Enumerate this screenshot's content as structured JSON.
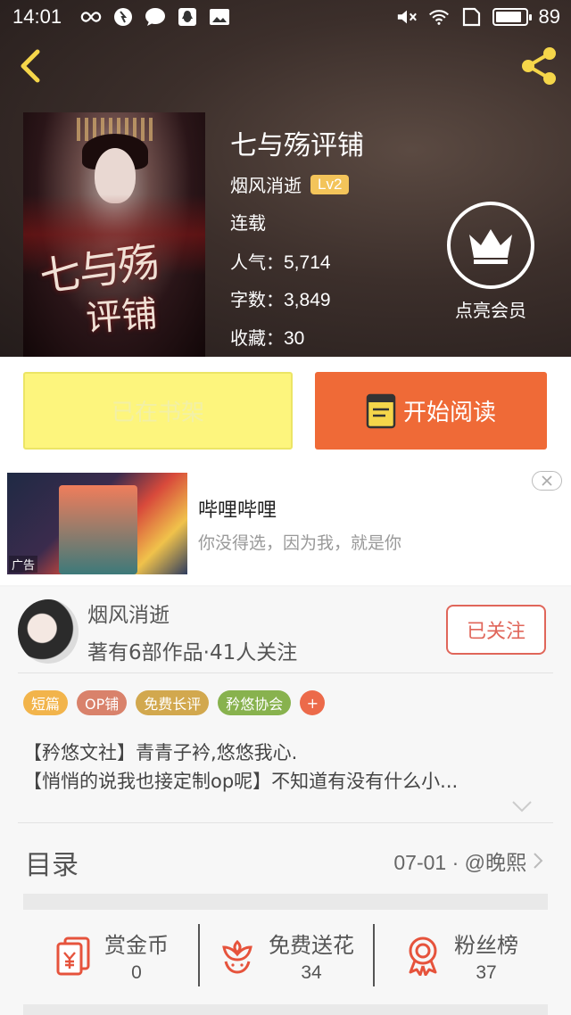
{
  "status_bar": {
    "time": "14:01",
    "battery_pct": "89",
    "battery_level": 0.89
  },
  "book": {
    "title": "七与殇评铺",
    "author": "烟风消逝",
    "level": "Lv2",
    "status": "连载",
    "popularity_label": "人气：",
    "popularity": "5,714",
    "words_label": "字数：",
    "words": "3,849",
    "favorites_label": "收藏：",
    "favorites": "30",
    "cover_title": "七与殇",
    "cover_subtitle": "评铺"
  },
  "vip": {
    "label": "点亮会员"
  },
  "actions": {
    "shelf_label": "已在书架",
    "read_label": "开始阅读"
  },
  "ad": {
    "title": "哔哩哔哩",
    "description": "你没得选，因为我，就是你",
    "tag": "广告"
  },
  "author_panel": {
    "name": "烟风消逝",
    "stats": "著有6部作品·41人关注",
    "follow_label": "已关注",
    "tags": [
      {
        "label": "短篇",
        "color": "#f2b44b"
      },
      {
        "label": "OP铺",
        "color": "#d9826b"
      },
      {
        "label": "免费长评",
        "color": "#d2a84e"
      },
      {
        "label": "矜悠协会",
        "color": "#88b24e"
      }
    ],
    "tag_more": "+",
    "description": [
      "【矜悠文社】青青子衿,悠悠我心.",
      "【悄悄的说我也接定制op呢】不知道有没有什么小..."
    ]
  },
  "toc": {
    "label": "目录",
    "latest": "07-01 · @晚熙"
  },
  "stats": [
    {
      "label": "赏金币",
      "value": "0",
      "icon": "reward-coin-icon"
    },
    {
      "label": "免费送花",
      "value": "34",
      "icon": "flower-icon"
    },
    {
      "label": "粉丝榜",
      "value": "37",
      "icon": "medal-icon"
    }
  ],
  "colors": {
    "accent": "#ef6a37",
    "shelf": "#fdf57d",
    "follow": "#e0665a",
    "icon_red": "#e6533c",
    "share_yellow": "#f5d64a"
  }
}
